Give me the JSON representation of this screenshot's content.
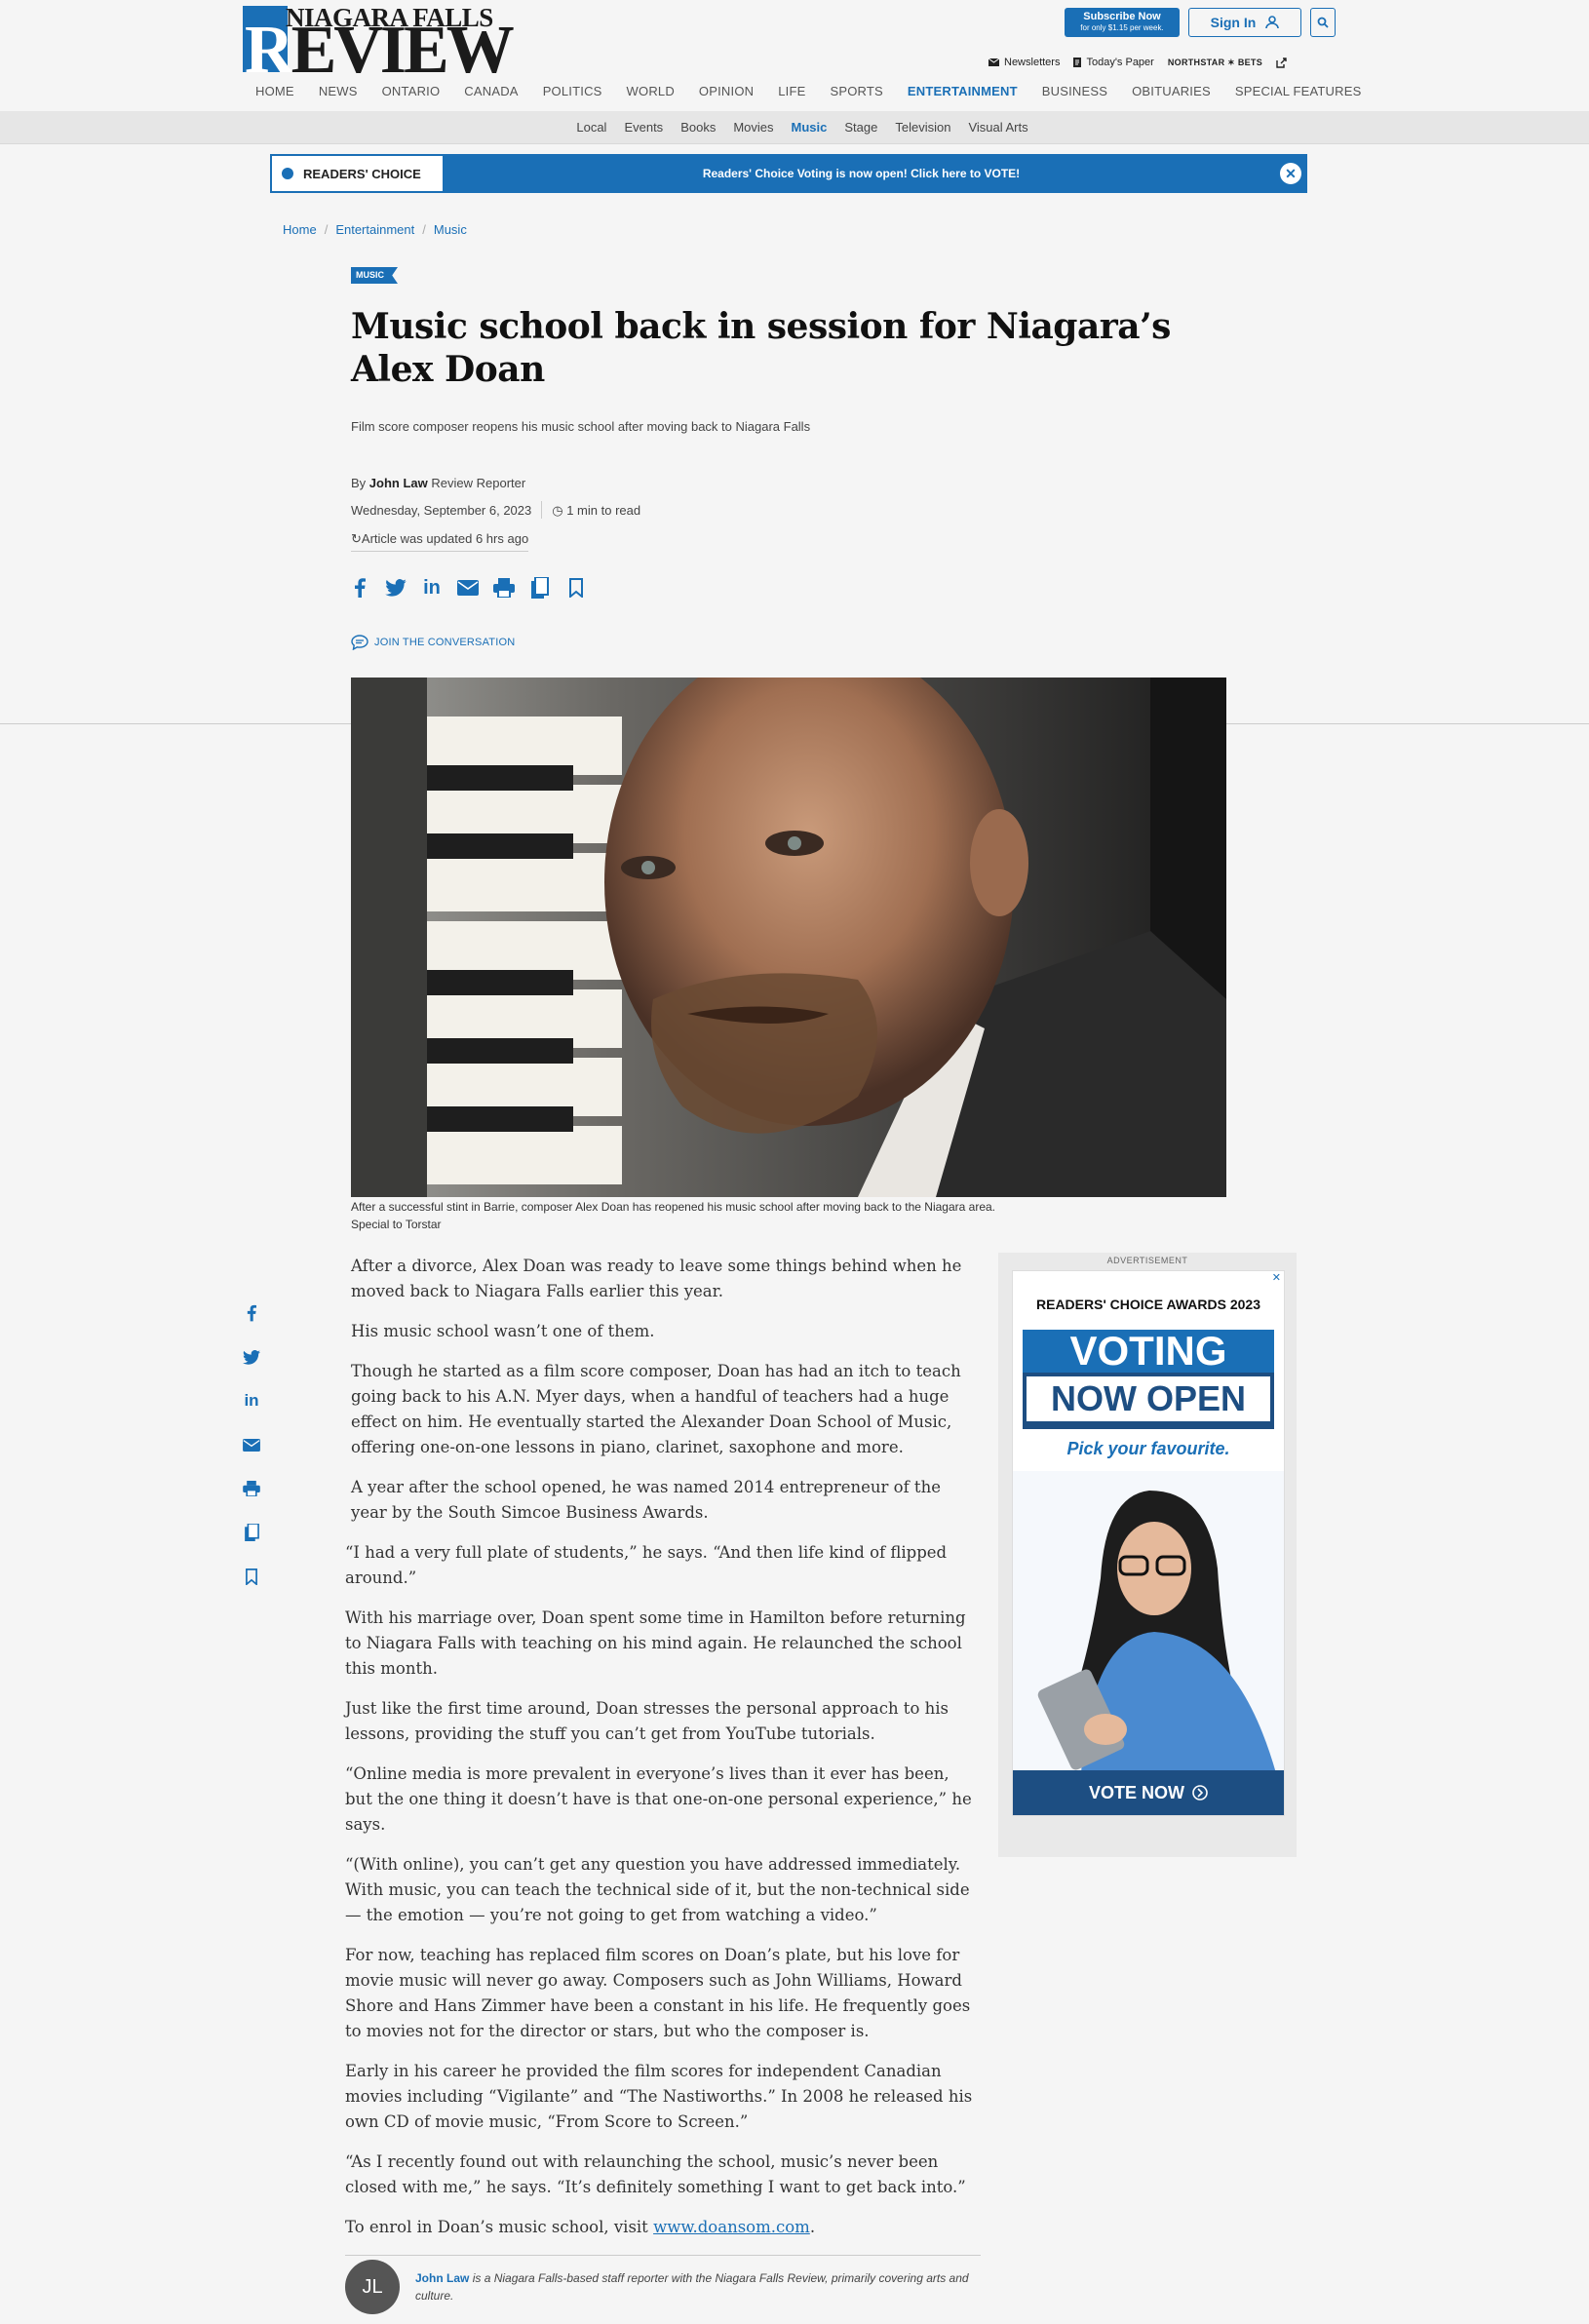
{
  "header": {
    "logo_top": "NIAGARA FALLS",
    "logo_main": "REVIEW",
    "subscribe_label": "Subscribe Now",
    "subscribe_sub": "for only $1.15 per week.",
    "signin_label": "Sign In",
    "utils": {
      "newsletters": "Newsletters",
      "todays_paper": "Today's Paper",
      "northstar": "NORTHSTAR ✶ BETS"
    },
    "nav": [
      "HOME",
      "NEWS",
      "ONTARIO",
      "CANADA",
      "POLITICS",
      "WORLD",
      "OPINION",
      "LIFE",
      "SPORTS",
      "ENTERTAINMENT",
      "BUSINESS",
      "OBITUARIES",
      "SPECIAL FEATURES"
    ],
    "nav_active": "ENTERTAINMENT",
    "subnav": [
      "Local",
      "Events",
      "Books",
      "Movies",
      "Music",
      "Stage",
      "Television",
      "Visual Arts"
    ],
    "subnav_active": "Music"
  },
  "banner": {
    "label": "READERS' CHOICE",
    "message": "Readers' Choice Voting is now open! Click here to VOTE!"
  },
  "breadcrumb": [
    "Home",
    "Entertainment",
    "Music"
  ],
  "article": {
    "tag": "MUSIC",
    "title": "Music school back in session for Niagara’s Alex Doan",
    "dek": "Film score composer reopens his music school after moving back to Niagara Falls",
    "byline_prefix": "By",
    "author": "John Law",
    "author_role": "Review Reporter",
    "date": "Wednesday, September 6, 2023",
    "read_time": "1 min to read",
    "updated": "Article was updated 6 hrs ago",
    "conversation": "JOIN THE CONVERSATION",
    "caption": "After a successful stint in Barrie, composer Alex Doan has reopened his music school after moving back to the Niagara area.",
    "credit": "Special to Torstar",
    "paragraphs": [
      "After a divorce, Alex Doan was ready to leave some things behind when he moved back to Niagara Falls earlier this year.",
      "His music school wasn’t one of them.",
      "Though he started as a film score composer, Doan has had an itch to teach going back to his A.N. Myer days, when a handful of teachers had a huge effect on him. He eventually started the Alexander Doan School of Music, offering one-on-one lessons in piano, clarinet, saxophone and more.",
      "A year after the school opened, he was named 2014 entrepreneur of the year by the South Simcoe Business Awards.",
      "“I had a very full plate of students,” he says. “And then life kind of flipped around.”",
      "With his marriage over, Doan spent some time in Hamilton before returning to Niagara Falls with teaching on his mind again. He relaunched the school this month.",
      "Just like the first time around, Doan stresses the personal approach to his lessons, providing the stuff you can’t get from YouTube tutorials.",
      "“Online media is more prevalent in everyone’s lives than it ever has been, but the one thing it doesn’t have is that one-on-one personal experience,” he says.",
      "“(With online), you can’t get any question you have addressed immediately. With music, you can teach the technical side of it, but the non-technical side — the emotion — you’re not going to get from watching a video.”",
      "For now, teaching has replaced film scores on Doan’s plate, but his love for movie music will never go away. Composers such as John Williams, Howard Shore and Hans Zimmer have been a constant in his life. He frequently goes to movies not for the director or stars, but who the composer is.",
      "Early in his career he provided the film scores for independent Canadian movies including “Vigilante” and “The Nastiworths.” In 2008 he released his own CD of movie music, “From Score to Screen.”",
      "“As I recently found out with relaunching the school, music’s never been closed with me,” he says. “It’s definitely something I want to get back into.”"
    ],
    "enrol_text": "To enrol in Doan’s music school, visit",
    "enrol_link": "www.doansom.com",
    "enrol_end": "."
  },
  "author_box": {
    "initials": "JL",
    "name": "John Law",
    "bio": "is a Niagara Falls-based staff reporter with the Niagara Falls Review, primarily covering arts and culture."
  },
  "ad": {
    "label": "ADVERTISEMENT",
    "title": "READERS' CHOICE AWARDS 2023",
    "line1": "VOTING",
    "line2": "NOW OPEN",
    "pick": "Pick your favourite.",
    "cta": "VOTE NOW"
  },
  "colors": {
    "brand": "#1a6fb6",
    "dark_brand": "#1d4e82"
  }
}
